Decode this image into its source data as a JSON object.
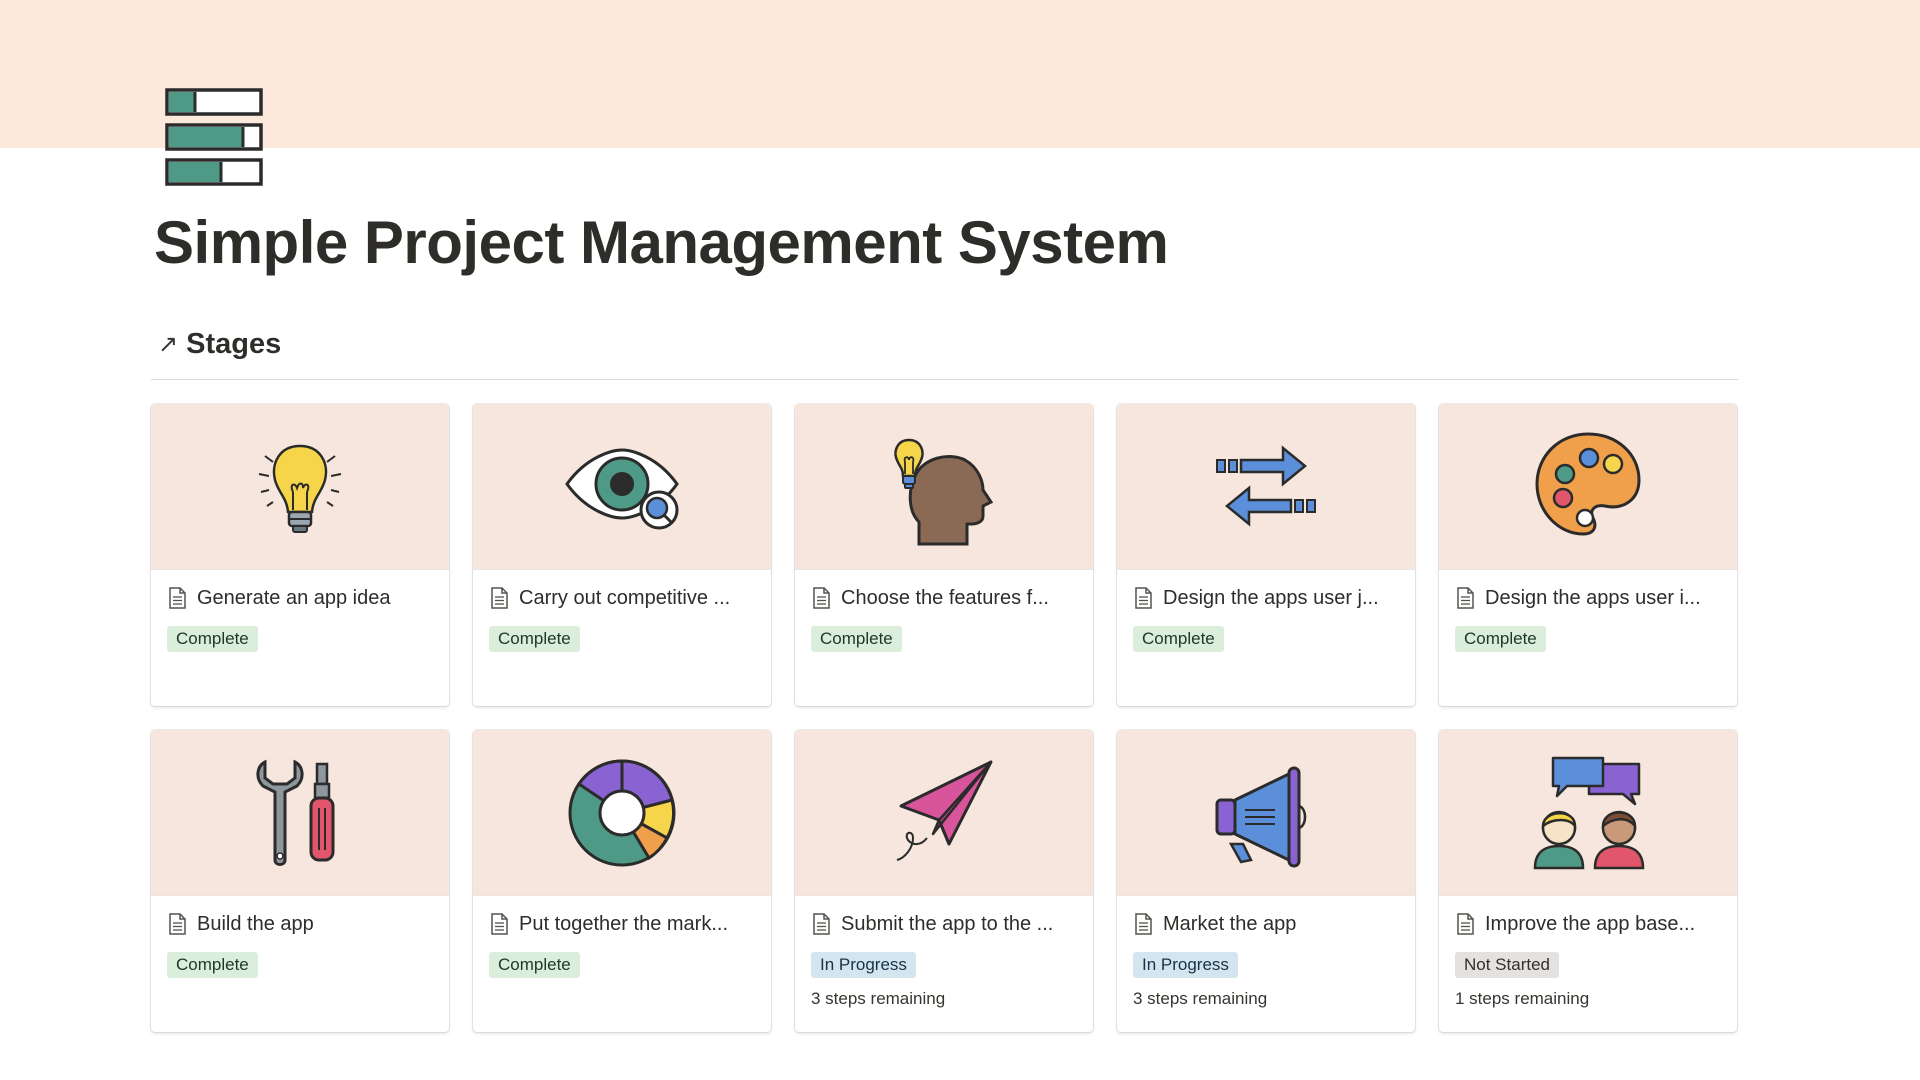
{
  "page": {
    "title": "Simple Project Management System",
    "cover_color": "#fde9dc",
    "icon": "progress-bars-icon"
  },
  "section": {
    "arrow": "↗",
    "title": "Stages"
  },
  "status_colors": {
    "Complete": {
      "bg": "#dbeddb",
      "fg": "#1c3829"
    },
    "In Progress": {
      "bg": "#d3e5ef",
      "fg": "#183347"
    },
    "Not Started": {
      "bg": "#e3e2e0",
      "fg": "#32302c"
    }
  },
  "cards": [
    {
      "title": "Generate an app idea",
      "status": "Complete",
      "steps": "",
      "icon": "lightbulb-icon"
    },
    {
      "title": "Carry out competitive ...",
      "status": "Complete",
      "steps": "",
      "icon": "eye-magnifier-icon"
    },
    {
      "title": "Choose the features f...",
      "status": "Complete",
      "steps": "",
      "icon": "head-idea-icon"
    },
    {
      "title": "Design the apps user j...",
      "status": "Complete",
      "steps": "",
      "icon": "arrows-exchange-icon"
    },
    {
      "title": "Design the apps user i...",
      "status": "Complete",
      "steps": "",
      "icon": "paint-palette-icon"
    },
    {
      "title": "Build the app",
      "status": "Complete",
      "steps": "",
      "icon": "wrench-screwdriver-icon"
    },
    {
      "title": "Put together the mark...",
      "status": "Complete",
      "steps": "",
      "icon": "donut-chart-icon"
    },
    {
      "title": "Submit the app to the ...",
      "status": "In Progress",
      "steps": "3 steps remaining",
      "icon": "paper-plane-icon"
    },
    {
      "title": "Market the app",
      "status": "In Progress",
      "steps": "3 steps remaining",
      "icon": "megaphone-icon"
    },
    {
      "title": "Improve the app base...",
      "status": "Not Started",
      "steps": "1 steps remaining",
      "icon": "users-chat-icon"
    }
  ]
}
